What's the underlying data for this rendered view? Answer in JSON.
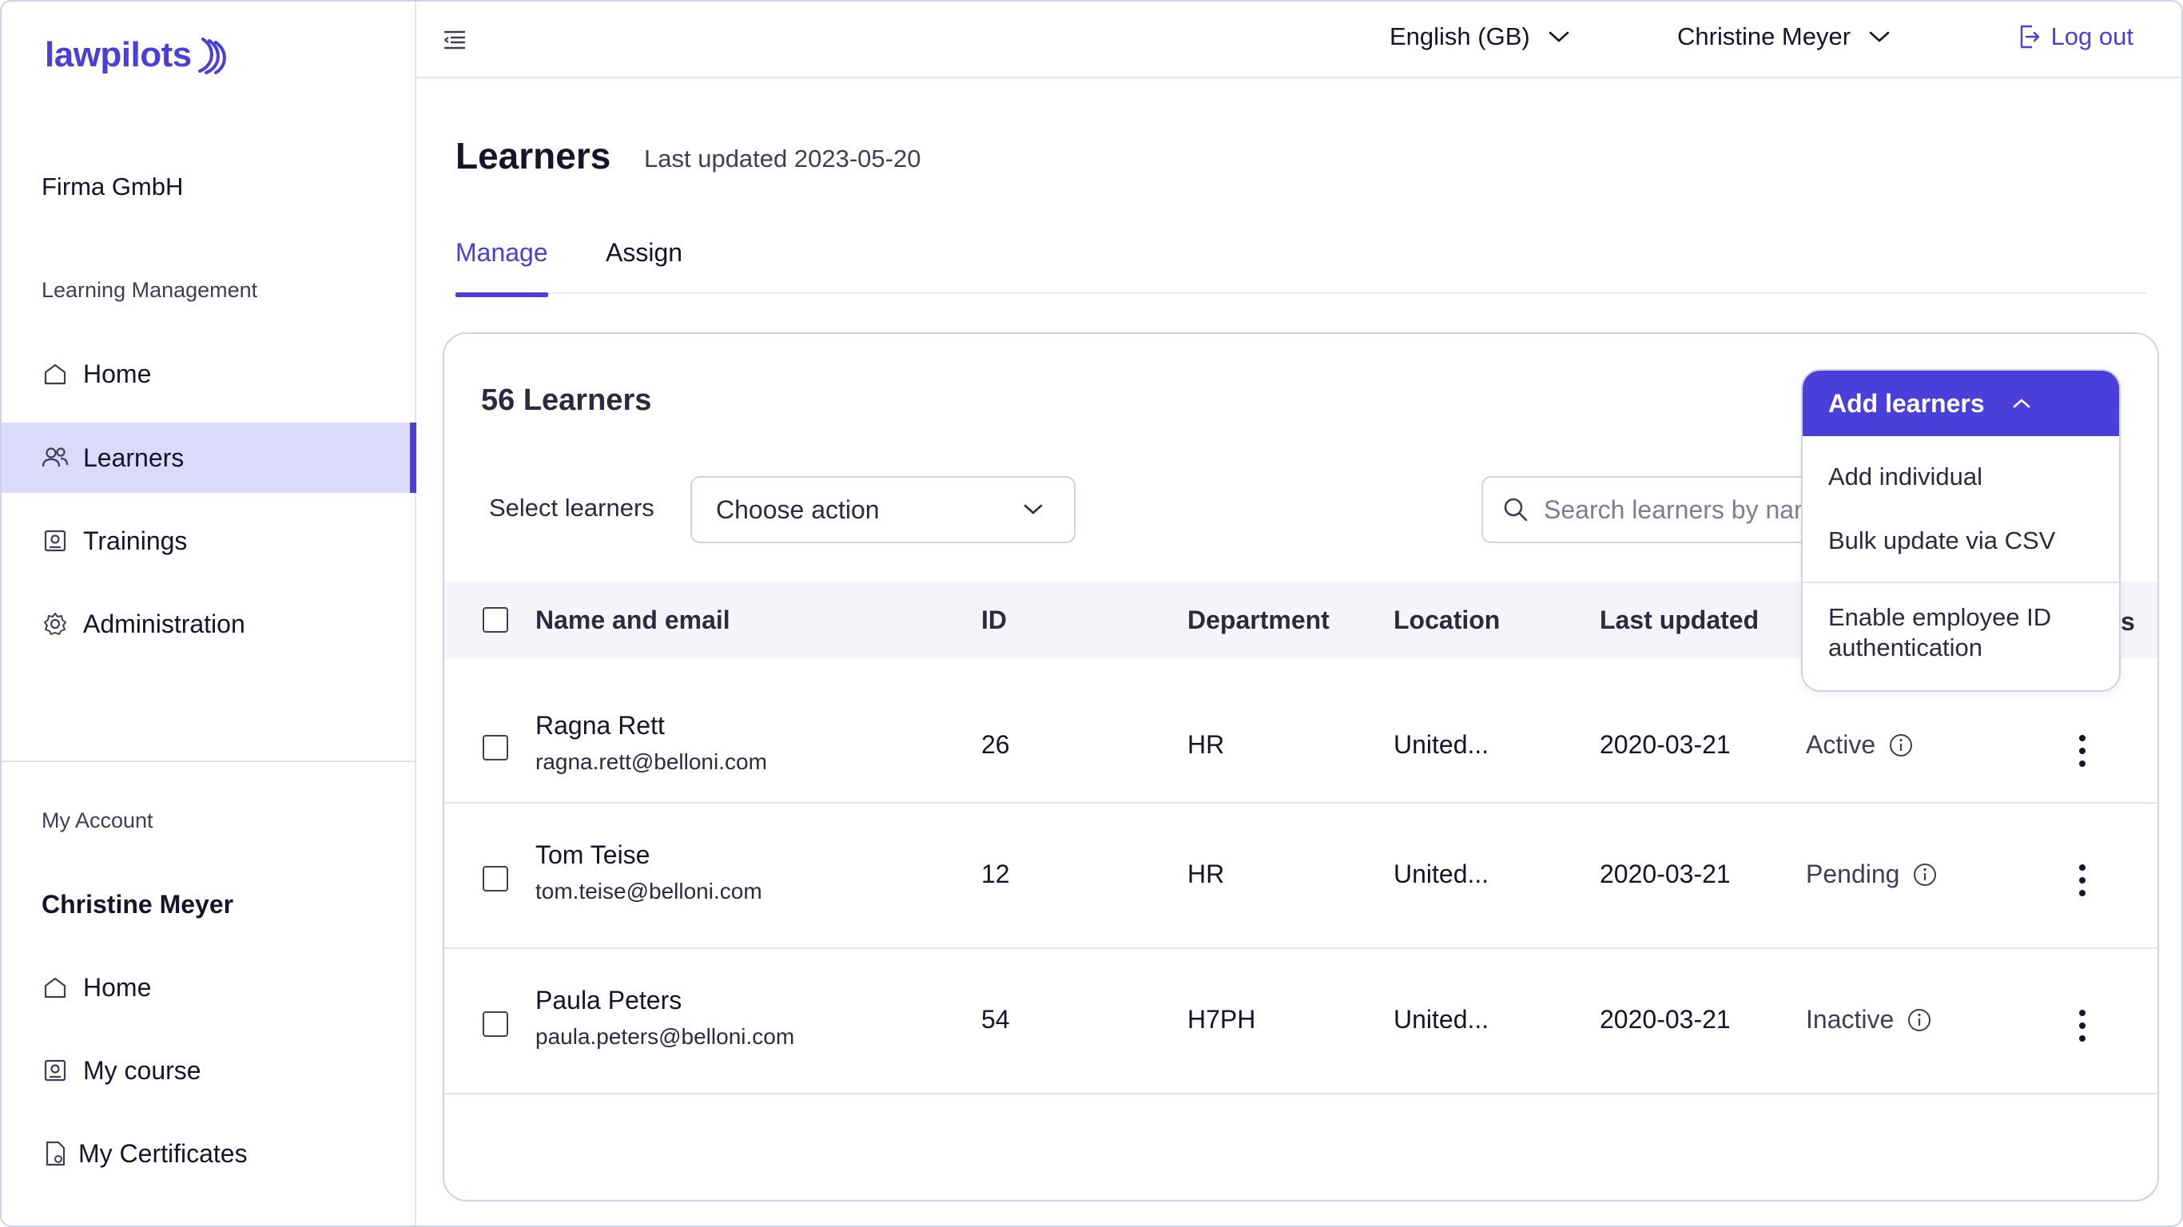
{
  "brand": {
    "name": "lawpilots",
    "color": "#4a3fd8"
  },
  "sidebar": {
    "organization": "Firma GmbH",
    "learning_section_label": "Learning Management",
    "learning_items": [
      {
        "label": "Home",
        "icon": "home-icon",
        "active": false
      },
      {
        "label": "Learners",
        "icon": "users-icon",
        "active": true
      },
      {
        "label": "Trainings",
        "icon": "training-icon",
        "active": false
      },
      {
        "label": "Administration",
        "icon": "gear-icon",
        "active": false
      }
    ],
    "account_section_label": "My Account",
    "user_name": "Christine Meyer",
    "account_items": [
      {
        "label": "Home",
        "icon": "home-icon"
      },
      {
        "label": "My course",
        "icon": "course-icon"
      },
      {
        "label": "My Certificates",
        "icon": "certificate-icon"
      }
    ]
  },
  "topbar": {
    "language": "English (GB)",
    "user": "Christine Meyer",
    "logout": "Log out"
  },
  "page": {
    "title": "Learners",
    "subtitle": "Last updated 2023-05-20",
    "tabs": [
      {
        "label": "Manage",
        "active": true
      },
      {
        "label": "Assign",
        "active": false
      }
    ]
  },
  "card": {
    "count": "56 Learners",
    "select_label": "Select learners",
    "action_select": "Choose action",
    "search_placeholder": "Search learners by name or email",
    "columns": [
      "Name and email",
      "ID",
      "Department",
      "Location",
      "Last updated"
    ],
    "column_tail": "s",
    "rows": [
      {
        "name": "Ragna Rett",
        "email": "ragna.rett@belloni.com",
        "id": "26",
        "department": "HR",
        "location": "United...",
        "updated": "2020-03-21",
        "status": "Active"
      },
      {
        "name": "Tom Teise",
        "email": "tom.teise@belloni.com",
        "id": "12",
        "department": "HR",
        "location": "United...",
        "updated": "2020-03-21",
        "status": "Pending"
      },
      {
        "name": "Paula Peters",
        "email": "paula.peters@belloni.com",
        "id": "54",
        "department": "H7PH",
        "location": "United...",
        "updated": "2020-03-21",
        "status": "Inactive"
      }
    ]
  },
  "add_menu": {
    "button": "Add learners",
    "items": [
      "Add individual",
      "Bulk update via CSV"
    ],
    "extra_line1": "Enable employee ID",
    "extra_line2": "authentication"
  }
}
